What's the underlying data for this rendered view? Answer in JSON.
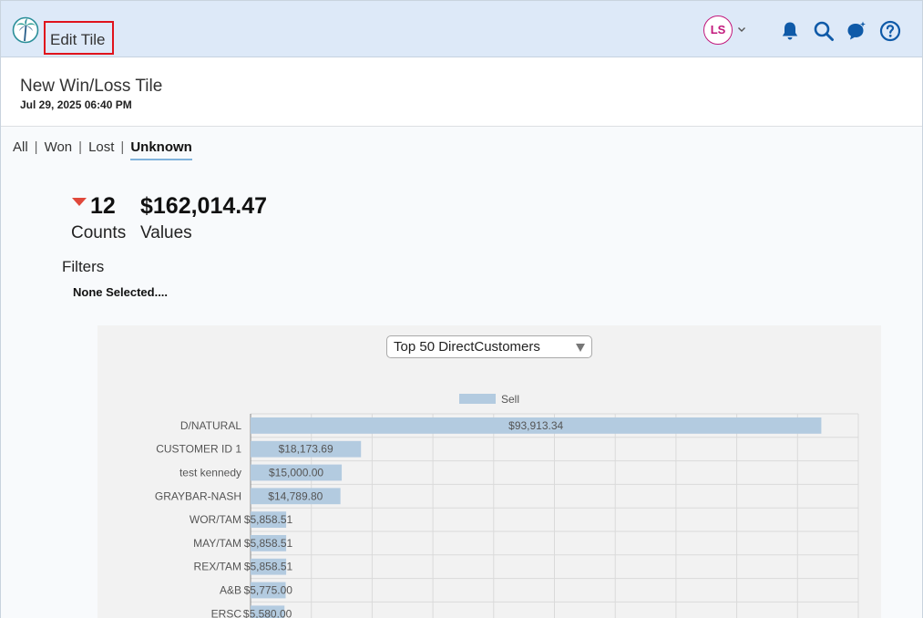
{
  "header": {
    "edit_label": "Edit Tile",
    "avatar_initials": "LS",
    "icons": [
      "palm-tree-logo-icon",
      "chevron-down-icon",
      "bell-icon",
      "search-icon",
      "comment-icon",
      "help-icon"
    ],
    "colors": {
      "header_bg": "#dde9f8",
      "avatar_accent": "#c2187c",
      "icon_blue": "#0f5aa8",
      "highlight_border": "#e0131c"
    }
  },
  "tile": {
    "title": "New Win/Loss Tile",
    "date": "Jul 29, 2025 06:40 PM"
  },
  "tabs": [
    {
      "label": "All",
      "active": false
    },
    {
      "label": "Won",
      "active": false
    },
    {
      "label": "Lost",
      "active": false
    },
    {
      "label": "Unknown",
      "active": true
    }
  ],
  "tab_separator": "|",
  "stats": {
    "count": "12",
    "count_label": "Counts",
    "value": "$162,014.47",
    "value_label": "Values",
    "trend": "down",
    "trend_color": "#e0483b"
  },
  "filters": {
    "label": "Filters",
    "value": "None Selected...."
  },
  "chart_select": {
    "selected": "Top 50 DirectCustomers"
  },
  "chart_data": {
    "type": "bar",
    "orientation": "horizontal",
    "legend": [
      "Sell"
    ],
    "legend_position": "top",
    "grid": true,
    "bar_color": "#b3cbe0",
    "xlim": [
      0,
      100000
    ],
    "categories": [
      "D/NATURAL",
      "CUSTOMER ID 1",
      "test kennedy",
      "GRAYBAR-NASH",
      "WOR/TAM",
      "MAY/TAM",
      "REX/TAM",
      "A&B",
      "ERSC"
    ],
    "series": [
      {
        "name": "Sell",
        "values": [
          93913.34,
          18173.69,
          15000.0,
          14789.8,
          5858.51,
          5858.51,
          5858.51,
          5775.0,
          5580.0
        ],
        "labels": [
          "$93,913.34",
          "$18,173.69",
          "$15,000.00",
          "$14,789.80",
          "$5,858.51",
          "$5,858.51",
          "$5,858.51",
          "$5,775.00",
          "$5,580.00"
        ]
      }
    ]
  }
}
